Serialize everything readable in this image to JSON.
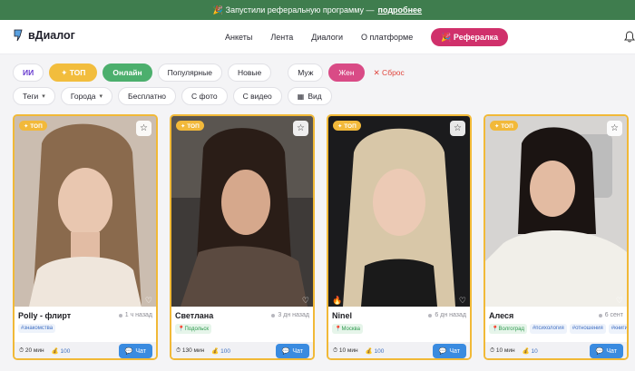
{
  "banner": {
    "text": "🎉 Запустили реферальную программу —",
    "link": "подробнее"
  },
  "header": {
    "logo": "вДиалог",
    "nav": [
      "Анкеты",
      "Лента",
      "Диалоги",
      "О платформе"
    ],
    "referral": "🎉 Рефералка"
  },
  "filters": {
    "ai": "ИИ",
    "top": "✦ ТОП",
    "online": "Онлайн",
    "popular": "Популярные",
    "new": "Новые",
    "male": "Муж",
    "female": "Жен",
    "reset": "✕ Сброс",
    "tags": "Теги",
    "cities": "Города",
    "free": "Бесплатно",
    "with_photo": "С фото",
    "with_video": "С видео",
    "view": "Вид"
  },
  "cards": [
    {
      "badge": "✦ ТОП",
      "name": "Polly - флирт",
      "seen": "1 ч назад",
      "tags": [
        "#знакомства"
      ],
      "time": "20 мин",
      "coins": "100",
      "chat": "Чат"
    },
    {
      "badge": "✦ ТОП",
      "name": "Светлана",
      "seen": "3 дн назад",
      "location": "Подольск",
      "tags": [],
      "time": "130 мин",
      "coins": "100",
      "chat": "Чат"
    },
    {
      "badge": "✦ ТОП",
      "name": "Ninel",
      "seen": "6 дн назад",
      "location": "Москва",
      "tags": [],
      "time": "10 мин",
      "coins": "100",
      "chat": "Чат"
    },
    {
      "badge": "✦ ТОП",
      "name": "Алеся",
      "seen": "6 сент",
      "location": "Волгоград",
      "tags": [
        "#психология",
        "#отношения",
        "#книги"
      ],
      "time": "10 мин",
      "coins": "10",
      "chat": "Чат"
    }
  ],
  "colors": {
    "accent": "#d0306b",
    "top": "#f2bd3d",
    "online": "#4caf6d",
    "chat": "#3a8be0",
    "banner": "#3f7d4e"
  }
}
